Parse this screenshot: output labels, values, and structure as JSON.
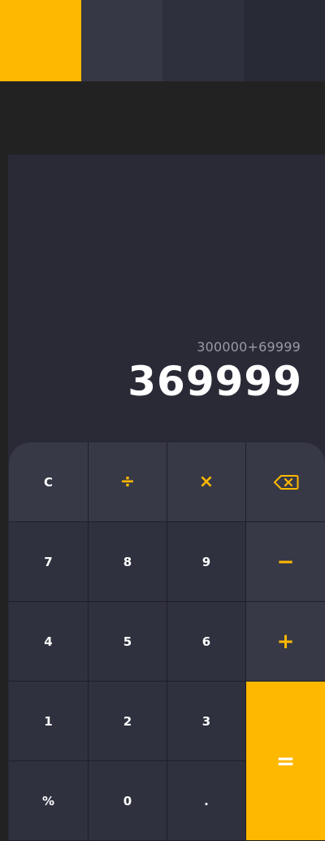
{
  "colors": {
    "accent": "#ffb800",
    "background": "#222222",
    "panel": "#292a36",
    "key": "#2f313f",
    "key_alt": "#373947",
    "swatches": [
      "#ffb800",
      "#363846",
      "#2e303d",
      "#282a35"
    ]
  },
  "display": {
    "expression": "300000+69999",
    "result": "369999"
  },
  "keys": {
    "clear": "C",
    "divide": "÷",
    "multiply": "×",
    "backspace_icon": "backspace-icon",
    "seven": "7",
    "eight": "8",
    "nine": "9",
    "minus": "−",
    "four": "4",
    "five": "5",
    "six": "6",
    "plus": "+",
    "one": "1",
    "two": "2",
    "three": "3",
    "equals": "=",
    "percent": "%",
    "zero": "0",
    "decimal": "."
  }
}
